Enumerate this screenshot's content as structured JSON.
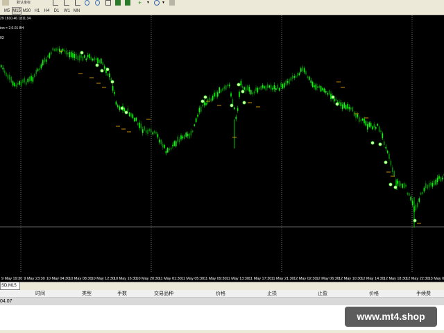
{
  "toolbar": {
    "zoom_label": "默认坐标",
    "timeframes": [
      "M5",
      "M15",
      "M30",
      "H1",
      "H4",
      "D1",
      "W1",
      "MN"
    ],
    "active_timeframe": "M15"
  },
  "chart": {
    "info_line1": "29 1810.46 1811.34",
    "info_line2": "ion = 2.0.01 8H",
    "info_line3": "03",
    "bull_color": "#00ff00",
    "bear_color": "#008a00",
    "time_labels": [
      "9 May 19:30",
      "9 May 23:30",
      "10 May 04:30",
      "10 May 08:30",
      "10 May 12:30",
      "10 May 16:30",
      "10 May 20:30",
      "11 May 01:30",
      "11 May 05:30",
      "11 May 09:30",
      "11 May 13:30",
      "11 May 17:30",
      "11 May 21:30",
      "12 May 02:30",
      "12 May 06:30",
      "12 May 10:30",
      "12 May 14:30",
      "12 May 18:30",
      "12 May 22:30",
      "13 May 03:"
    ]
  },
  "chart_tabs": {
    "active": "SD,M15"
  },
  "terminal": {
    "columns": [
      "时间",
      "类型",
      "手数",
      "交易品种",
      "价格",
      "止损",
      "止盈",
      "价格",
      "手续费"
    ],
    "balance_fragment": "04.07"
  },
  "watermark": {
    "text": "www.mt4.shop"
  }
}
